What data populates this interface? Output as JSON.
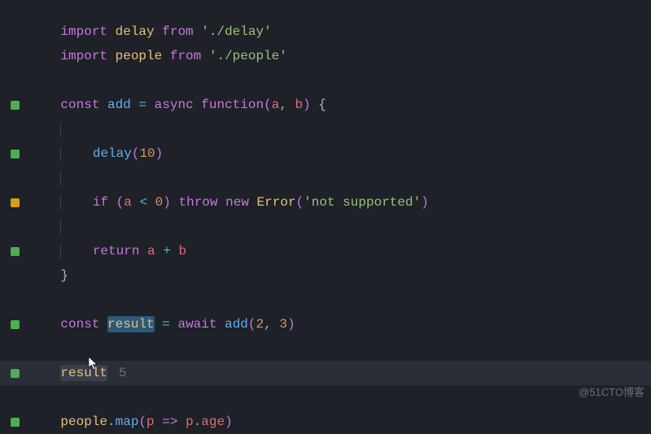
{
  "lines": {
    "l1": {
      "import": "import",
      "delay": "delay",
      "from": "from",
      "path": "'./delay'"
    },
    "l2": {
      "import": "import",
      "people": "people",
      "from": "from",
      "path": "'./people'"
    },
    "l4": {
      "const": "const",
      "add": "add",
      "eq": "=",
      "async": "async",
      "function": "function",
      "a": "a",
      "b": "b"
    },
    "l6": {
      "delay": "delay",
      "n": "10"
    },
    "l8": {
      "if": "if",
      "a": "a",
      "lt": "<",
      "z": "0",
      "throw": "throw",
      "new": "new",
      "Error": "Error",
      "msg": "'not supported'"
    },
    "l10": {
      "return": "return",
      "a": "a",
      "plus": "+",
      "b": "b"
    },
    "l13": {
      "const": "const",
      "result": "result",
      "eq": "=",
      "await": "await",
      "add": "add",
      "n1": "2",
      "n2": "3"
    },
    "l15": {
      "result": "result",
      "val": "5"
    },
    "l17": {
      "people": "people",
      "map": "map",
      "p": "p",
      "arrow": "=>",
      "p2": "p",
      "age": "age"
    }
  },
  "watermark": "@51CTO博客"
}
